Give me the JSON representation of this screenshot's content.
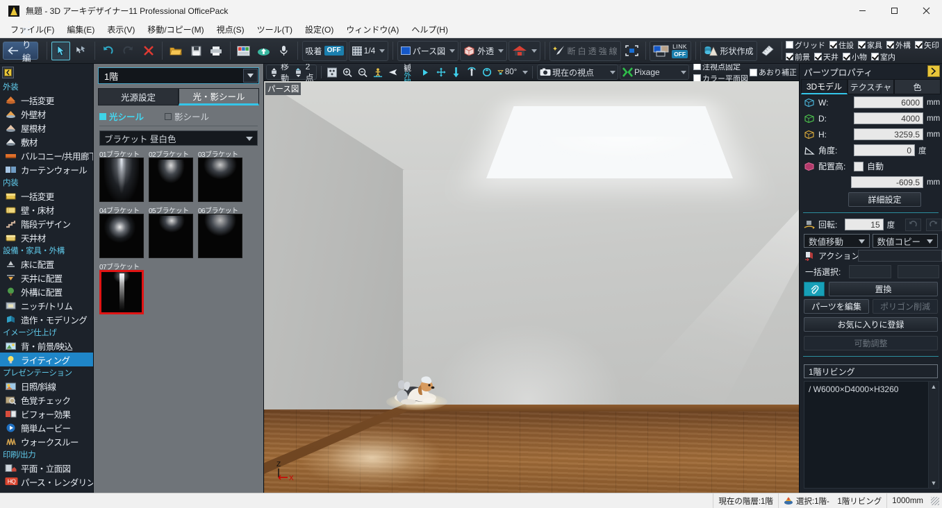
{
  "window": {
    "title": "無題 - 3D アーキデザイナー11 Professional OfficePack",
    "minimize": "—",
    "maximize": "□",
    "close": "✕"
  },
  "menubar": [
    {
      "label": "ファイル(F)"
    },
    {
      "label": "編集(E)"
    },
    {
      "label": "表示(V)"
    },
    {
      "label": "移動/コピー(M)"
    },
    {
      "label": "視点(S)"
    },
    {
      "label": "ツール(T)"
    },
    {
      "label": "設定(O)"
    },
    {
      "label": "ウィンドウ(A)"
    },
    {
      "label": "ヘルプ(H)"
    }
  ],
  "toolbar": {
    "back_label": "間取り編集へ",
    "snap_label": "吸着",
    "snap_state": "OFF",
    "grid_ratio": "1/4",
    "view_mode": "パース図",
    "render_mode": "外透",
    "magic_labels": [
      "断",
      "白",
      "透",
      "強",
      "線"
    ],
    "link_label": "LINK",
    "link_state": "OFF",
    "shape_create": "形状作成",
    "checks": [
      {
        "label": "グリッド",
        "checked": false
      },
      {
        "label": "住設",
        "checked": true
      },
      {
        "label": "家具",
        "checked": true
      },
      {
        "label": "外構",
        "checked": true
      },
      {
        "label": "矢印",
        "checked": true
      },
      {
        "label": "前景",
        "checked": true
      },
      {
        "label": "天井",
        "checked": true
      },
      {
        "label": "小物",
        "checked": true
      },
      {
        "label": "室内",
        "checked": true
      }
    ]
  },
  "sidebar": {
    "groups": [
      {
        "title": "外装",
        "items": [
          {
            "label": "一括変更",
            "icon": "palette-orange-icon"
          },
          {
            "label": "外壁材",
            "icon": "wall-material-icon"
          },
          {
            "label": "屋根材",
            "icon": "roof-material-icon"
          },
          {
            "label": "敷材",
            "icon": "paving-material-icon"
          },
          {
            "label": "バルコニー/共用廊下",
            "icon": "balcony-icon"
          },
          {
            "label": "カーテンウォール",
            "icon": "curtain-wall-icon"
          }
        ]
      },
      {
        "title": "内装",
        "items": [
          {
            "label": "一括変更",
            "icon": "batch-change-icon"
          },
          {
            "label": "壁・床材",
            "icon": "wall-floor-material-icon"
          },
          {
            "label": "階段デザイン",
            "icon": "stair-design-icon"
          },
          {
            "label": "天井材",
            "icon": "ceiling-material-icon"
          }
        ]
      },
      {
        "title": "設備・家具・外構",
        "items": [
          {
            "label": "床に配置",
            "icon": "place-on-floor-icon"
          },
          {
            "label": "天井に配置",
            "icon": "place-on-ceiling-icon"
          },
          {
            "label": "外構に配置",
            "icon": "place-exterior-icon"
          },
          {
            "label": "ニッチ/トリム",
            "icon": "niche-trim-icon"
          },
          {
            "label": "造作・モデリング",
            "icon": "modeling-icon"
          }
        ]
      },
      {
        "title": "イメージ仕上げ",
        "items": [
          {
            "label": "背・前景/映込",
            "icon": "background-icon"
          },
          {
            "label": "ライティング",
            "icon": "lighting-icon",
            "active": true
          }
        ]
      },
      {
        "title": "プレゼンテーション",
        "items": [
          {
            "label": "日照/斜線",
            "icon": "sunlight-icon"
          },
          {
            "label": "色覚チェック",
            "icon": "color-vision-icon"
          },
          {
            "label": "ビフォー効果",
            "icon": "before-after-icon"
          },
          {
            "label": "簡単ムービー",
            "icon": "movie-icon"
          },
          {
            "label": "ウォークスルー",
            "icon": "walkthrough-icon"
          }
        ]
      },
      {
        "title": "印刷/出力",
        "items": [
          {
            "label": "平面・立面図",
            "icon": "plan-elevation-icon"
          },
          {
            "label": "パース・レンダリング",
            "icon": "hq-render-icon"
          }
        ]
      }
    ]
  },
  "light_panel": {
    "floor_selector": "1階",
    "tabs": [
      {
        "label": "光源設定",
        "selected": false
      },
      {
        "label": "光・影シール",
        "selected": true
      }
    ],
    "radios": [
      {
        "label": "光シール",
        "selected": true
      },
      {
        "label": "影シール",
        "selected": false
      }
    ],
    "category": "ブラケット 昼白色",
    "thumbnails": [
      {
        "caption": "01ブラケット",
        "pattern": "beam-up",
        "selected": false
      },
      {
        "caption": "02ブラケット",
        "pattern": "cone-narrow",
        "selected": false
      },
      {
        "caption": "03ブラケット",
        "pattern": "cone-wide",
        "selected": false
      },
      {
        "caption": "04ブラケット",
        "pattern": "glow-round",
        "selected": false
      },
      {
        "caption": "05ブラケット",
        "pattern": "half-dome",
        "selected": false
      },
      {
        "caption": "06ブラケット",
        "pattern": "dome-soft",
        "selected": false
      },
      {
        "caption": "07ブラケット",
        "pattern": "thin-beam",
        "selected": true
      }
    ]
  },
  "viewport": {
    "label": "パース図",
    "toolbar": {
      "move_label": "移動",
      "twopoint_label": "2点",
      "interior_label": "内観",
      "exterior_label": "外観",
      "angle_value": "80°",
      "viewpoint": "現在の視点",
      "pixage": "Pixage",
      "check_fixed_gaze": "注視点固定",
      "check_color_plan": "カラー平面図",
      "check_tilt_correct": "あおり補正"
    },
    "axis": {
      "z": "Z",
      "x": "X"
    }
  },
  "properties": {
    "title": "パーツプロパティ",
    "tabs": [
      {
        "label": "3Dモデル",
        "selected": true
      },
      {
        "label": "テクスチャ",
        "selected": false
      },
      {
        "label": "色",
        "selected": false
      }
    ],
    "fields": [
      {
        "label": "W:",
        "value": "6000",
        "unit": "mm",
        "icon": "width-cube-icon"
      },
      {
        "label": "D:",
        "value": "4000",
        "unit": "mm",
        "icon": "depth-cube-icon"
      },
      {
        "label": "H:",
        "value": "3259.5",
        "unit": "mm",
        "icon": "height-cube-icon"
      },
      {
        "label": "角度:",
        "value": "0",
        "unit": "度",
        "icon": "angle-icon"
      }
    ],
    "placement": {
      "label": "配置高:",
      "auto_label": "自動",
      "auto_checked": false,
      "value": "-609.5",
      "unit": "mm"
    },
    "detail_button": "詳細設定",
    "rotation": {
      "label": "回転:",
      "value": "15",
      "unit": "度"
    },
    "numeric_move": "数値移動",
    "numeric_copy": "数値コピー",
    "action_label": "アクション:",
    "action_value": "",
    "batch_select_label": "一括選択:",
    "buttons": {
      "replace": "置換",
      "edit_parts": "パーツを編集",
      "reduce_polygon": "ポリゴン削減",
      "add_favorite": "お気に入りに登録",
      "movable_adjust": "可動調整"
    },
    "selection_name": "1階リビング",
    "selection_dims": "/ W6000×D4000×H3260"
  },
  "statusbar": {
    "current_floor": "現在の階層:1階",
    "selection": "選択:1階-　1階リビング",
    "scale": "1000mm"
  },
  "colors": {
    "accent_cyan": "#34c6ea",
    "accent_blue": "#1f86c8",
    "selected_red": "#e01414",
    "panel_gray": "#6f7479",
    "dark_bg": "#1c222a"
  }
}
